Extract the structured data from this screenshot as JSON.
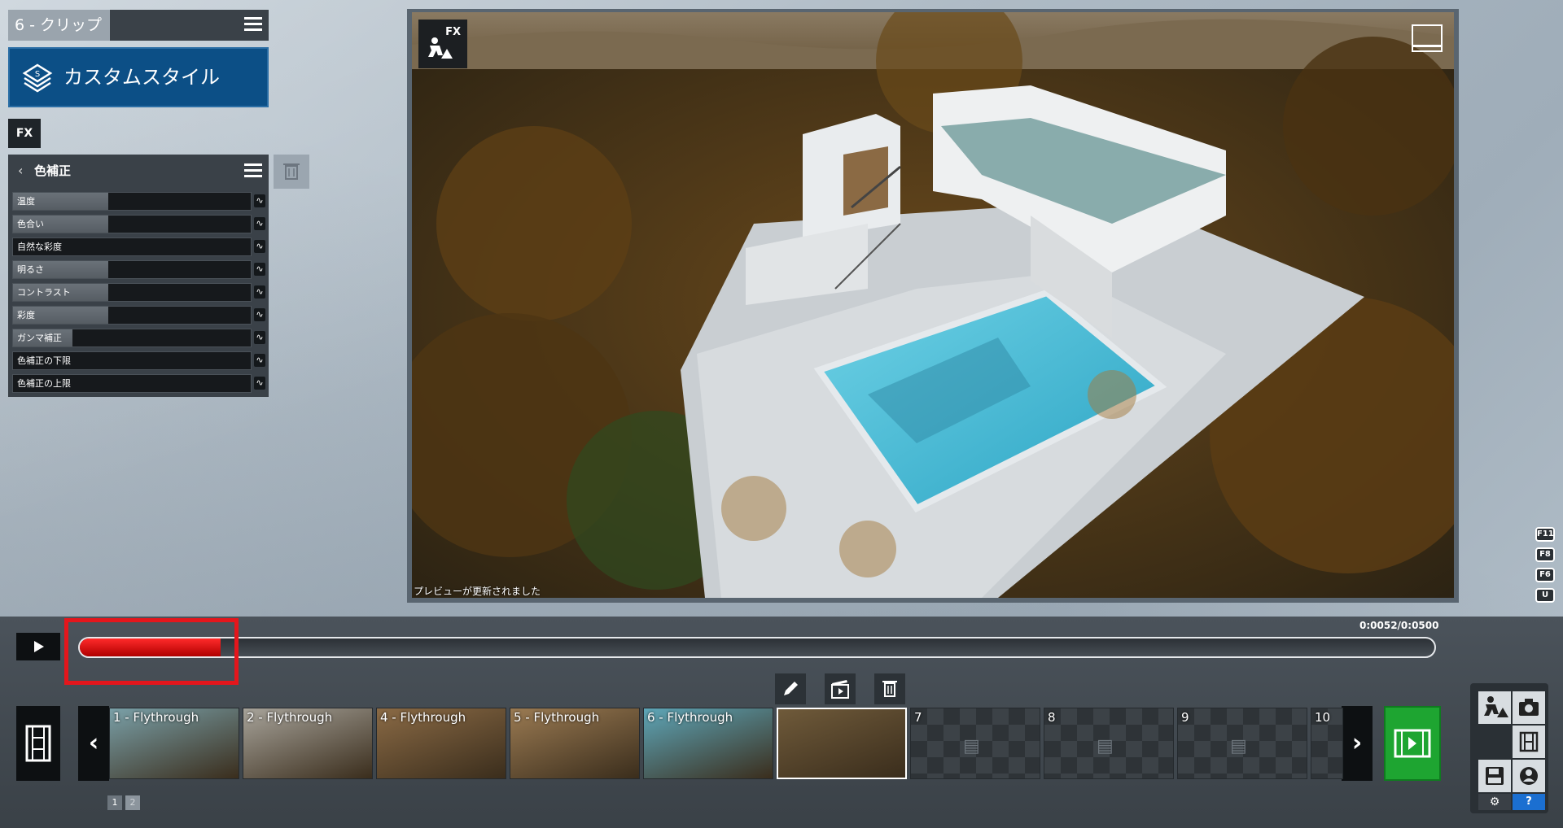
{
  "clip": {
    "title": "6 - クリップ"
  },
  "style": {
    "label": "カスタムスタイル"
  },
  "fx_badge": "FX",
  "color_correction": {
    "title": "色補正",
    "sliders": [
      {
        "label": "温度",
        "value": 0.4
      },
      {
        "label": "色合い",
        "value": 0.4
      },
      {
        "label": "自然な彩度",
        "value": 0.0
      },
      {
        "label": "明るさ",
        "value": 0.4
      },
      {
        "label": "コントラスト",
        "value": 0.4
      },
      {
        "label": "彩度",
        "value": 0.4
      },
      {
        "label": "ガンマ補正",
        "value": 0.25
      },
      {
        "label": "色補正の下限",
        "value": 0.0
      },
      {
        "label": "色補正の上限",
        "value": 0.0
      }
    ]
  },
  "viewport": {
    "fx_label": "FX",
    "status": "プレビューが更新されました"
  },
  "shortcut_keys": [
    "F11",
    "F8",
    "F6",
    "U"
  ],
  "timeline": {
    "time": "0:0052/0:0500",
    "progress": 0.104
  },
  "clips": [
    {
      "label": "1 - Flythrough",
      "empty": false
    },
    {
      "label": "2 - Flythrough",
      "empty": false
    },
    {
      "label": "4 - Flythrough",
      "empty": false
    },
    {
      "label": "5 - Flythrough",
      "empty": false
    },
    {
      "label": "6 - Flythrough",
      "empty": false
    },
    {
      "label": "",
      "empty": false,
      "selected": true
    },
    {
      "label": "7",
      "empty": true
    },
    {
      "label": "8",
      "empty": true
    },
    {
      "label": "9",
      "empty": true
    },
    {
      "label": "10",
      "empty": true
    }
  ],
  "pages": [
    "1",
    "2"
  ],
  "colors": {
    "accent_red": "#e4161c",
    "style_blue": "#0c4f86",
    "add_green": "#1ea531"
  }
}
